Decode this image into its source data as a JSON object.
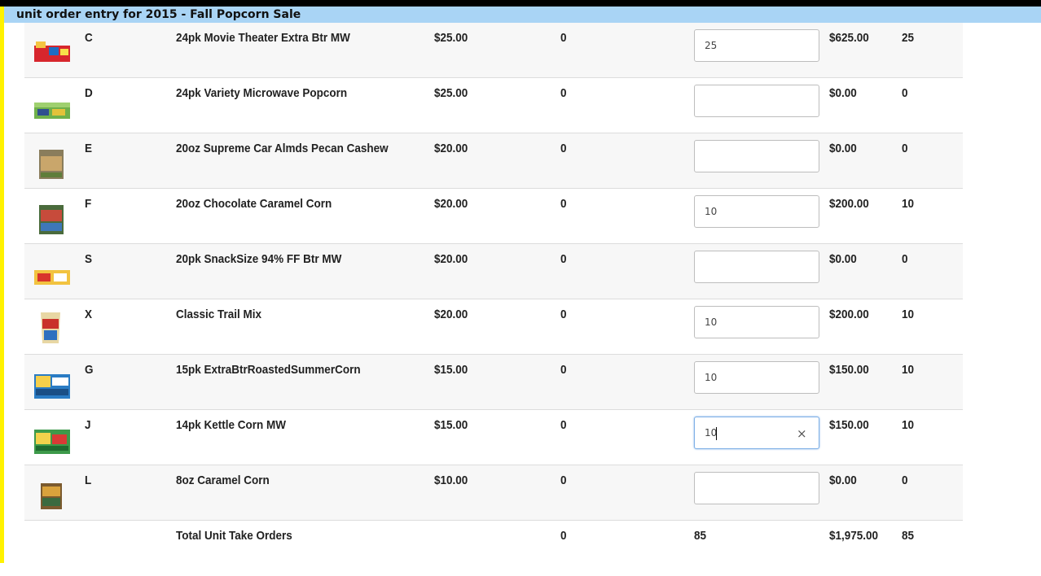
{
  "title": "unit order entry for 2015 - Fall Popcorn Sale",
  "rows": [
    {
      "code": "C",
      "desc": "24pk Movie Theater Extra Btr MW",
      "price": "$25.00",
      "prev": "0",
      "qty": "25",
      "amt": "$625.00",
      "units": "25",
      "thumb": "popcorn-box-red"
    },
    {
      "code": "D",
      "desc": "24pk Variety Microwave Popcorn",
      "price": "$25.00",
      "prev": "0",
      "qty": "",
      "amt": "$0.00",
      "units": "0",
      "thumb": "popcorn-box-green"
    },
    {
      "code": "E",
      "desc": "20oz Supreme Car Almds Pecan Cashew",
      "price": "$20.00",
      "prev": "0",
      "qty": "",
      "amt": "$0.00",
      "units": "0",
      "thumb": "tin-cashew"
    },
    {
      "code": "F",
      "desc": "20oz Chocolate Caramel Corn",
      "price": "$20.00",
      "prev": "0",
      "qty": "10",
      "amt": "$200.00",
      "units": "10",
      "thumb": "tin-chocolate"
    },
    {
      "code": "S",
      "desc": "20pk SnackSize 94% FF Btr MW",
      "price": "$20.00",
      "prev": "0",
      "qty": "",
      "amt": "$0.00",
      "units": "0",
      "thumb": "popcorn-box-yellow"
    },
    {
      "code": "X",
      "desc": "Classic Trail Mix",
      "price": "$20.00",
      "prev": "0",
      "qty": "10",
      "amt": "$200.00",
      "units": "10",
      "thumb": "trail-mix-bag"
    },
    {
      "code": "G",
      "desc": "15pk ExtraBtrRoastedSummerCorn",
      "price": "$15.00",
      "prev": "0",
      "qty": "10",
      "amt": "$150.00",
      "units": "10",
      "thumb": "popcorn-box-blue"
    },
    {
      "code": "J",
      "desc": "14pk Kettle Corn MW",
      "price": "$15.00",
      "prev": "0",
      "qty": "10",
      "amt": "$150.00",
      "units": "10",
      "thumb": "popcorn-box-green2"
    },
    {
      "code": "L",
      "desc": "8oz Caramel Corn",
      "price": "$10.00",
      "prev": "0",
      "qty": "",
      "amt": "$0.00",
      "units": "0",
      "thumb": "tin-caramel"
    }
  ],
  "total": {
    "label": "Total Unit Take Orders",
    "prev": "0",
    "qty": "85",
    "amt": "$1,975.00",
    "units": "85"
  },
  "clear_icon": "×",
  "colors": {
    "header_bg": "#a9d4f5",
    "left_accent": "#fff200",
    "focus_border": "#7fb0e6"
  }
}
